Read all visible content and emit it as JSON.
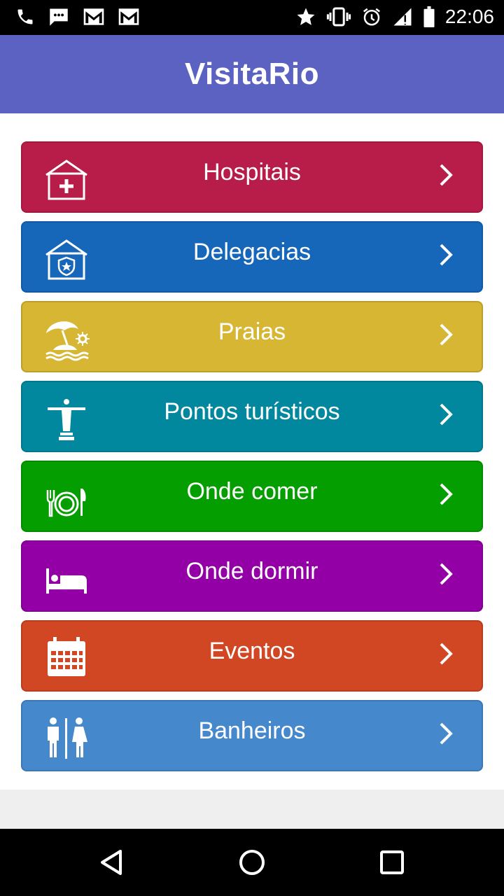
{
  "status_bar": {
    "time": "22:06",
    "left_icons": [
      "phone-icon",
      "sms-icon",
      "gmail-icon",
      "gmail-icon"
    ],
    "right_icons": [
      "star-icon",
      "vibrate-icon",
      "alarm-icon",
      "signal-icon",
      "battery-icon"
    ]
  },
  "app_bar": {
    "title": "VisitaRio"
  },
  "menu": {
    "items": [
      {
        "label": "Hospitais",
        "color": "#b81c48",
        "icon": "hospital-icon"
      },
      {
        "label": "Delegacias",
        "color": "#1666b9",
        "icon": "police-station-icon"
      },
      {
        "label": "Praias",
        "color": "#d6b632",
        "icon": "beach-icon"
      },
      {
        "label": "Pontos turísticos",
        "color": "#01889e",
        "icon": "christ-redeemer-icon"
      },
      {
        "label": "Onde comer",
        "color": "#049e00",
        "icon": "restaurant-icon"
      },
      {
        "label": "Onde dormir",
        "color": "#9200a6",
        "icon": "bed-icon"
      },
      {
        "label": "Eventos",
        "color": "#d14724",
        "icon": "calendar-icon"
      },
      {
        "label": "Banheiros",
        "color": "#4588cc",
        "icon": "restroom-icon"
      }
    ]
  },
  "nav_bar": {
    "buttons": [
      "back-icon",
      "home-icon",
      "recents-icon"
    ]
  }
}
